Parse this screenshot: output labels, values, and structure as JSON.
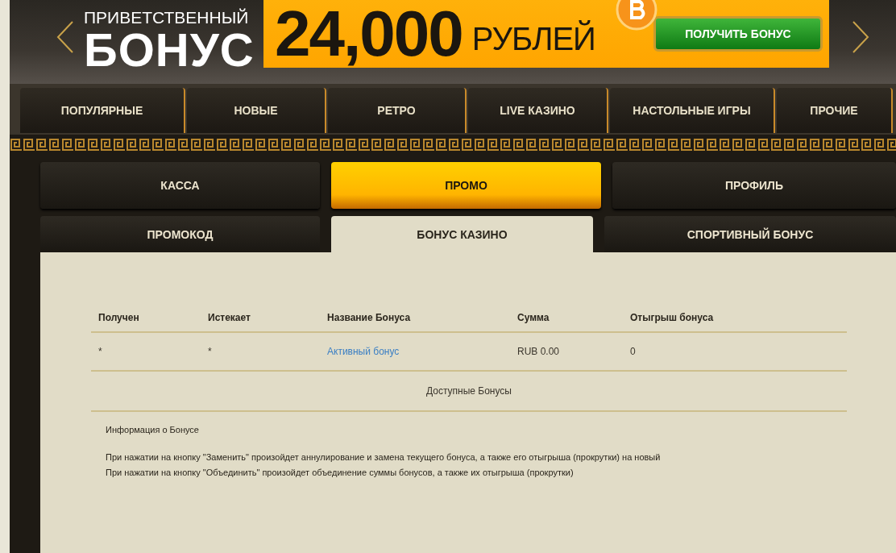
{
  "banner": {
    "greeting": "ПРИВЕТСТВЕННЫЙ",
    "title": "БОНУС",
    "amount": "24,000",
    "currency": "РУБЛЕЙ",
    "button": "ПОЛУЧИТЬ БОНУС"
  },
  "categories": [
    {
      "label": "ПОПУЛЯРНЫЕ"
    },
    {
      "label": "НОВЫЕ"
    },
    {
      "label": "РЕТРО"
    },
    {
      "label": "LIVE КАЗИНО"
    },
    {
      "label": "НАСТОЛЬНЫЕ ИГРЫ"
    },
    {
      "label": "ПРОЧИЕ"
    }
  ],
  "tabs": [
    {
      "label": "КАССА",
      "selected": false
    },
    {
      "label": "ПРОМО",
      "selected": true
    },
    {
      "label": "ПРОФИЛЬ",
      "selected": false
    }
  ],
  "subtabs": [
    {
      "label": "ПРОМОКОД",
      "selected": false
    },
    {
      "label": "БОНУС КАЗИНО",
      "selected": true
    },
    {
      "label": "СПОРТИВНЫЙ БОНУС",
      "selected": false
    }
  ],
  "table": {
    "columns": [
      "Получен",
      "Истекает",
      "Название Бонуса",
      "Сумма",
      "Отыгрыш бонуса"
    ],
    "rows": [
      {
        "received": "*",
        "expires": "*",
        "name": "Активный бонус",
        "amount": "RUB 0.00",
        "wagering": "0"
      }
    ],
    "footer": "Доступные Бонусы"
  },
  "info": {
    "title": "Информация о Бонусе",
    "lines": [
      "При нажатии на кнопку \"Заменить\" произойдет аннулирование и замена текущего бонуса, а также его отыгрыша (прокрутки) на новый",
      "При нажатии на кнопку \"Объединить\" произойдет объединение суммы бонусов, а также их отыгрыша (прокрутки)"
    ]
  }
}
